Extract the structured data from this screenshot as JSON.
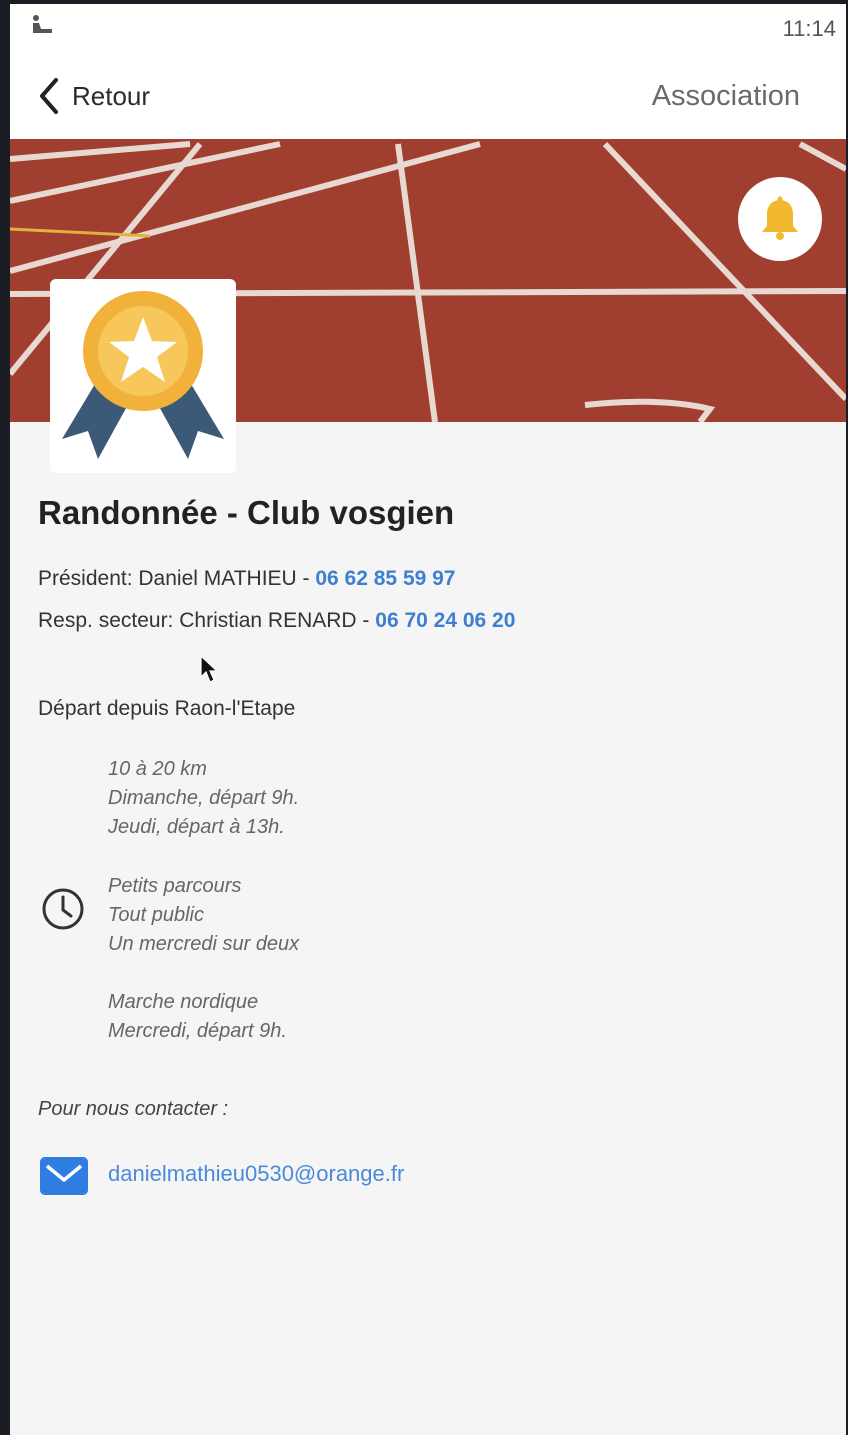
{
  "status_bar": {
    "time": "11:14",
    "left_icon": "accessibility-icon"
  },
  "nav": {
    "back_label": "Retour",
    "title": "Association"
  },
  "hero": {
    "bell_icon": "bell-icon",
    "logo_icon": "medal-icon"
  },
  "club": {
    "name": "Randonnée - Club vosgien",
    "president_label": "Président: Daniel MATHIEU - ",
    "president_phone": "06 62 85 59 97",
    "secteur_label": "Resp. secteur: Christian RENARD - ",
    "secteur_phone": "06 70 24 06 20",
    "depart": "Départ depuis Raon-l'Etape"
  },
  "schedule": [
    {
      "lines": [
        "10 à 20 km",
        "Dimanche, départ 9h.",
        "Jeudi, départ à 13h."
      ]
    },
    {
      "lines": [
        "Petits parcours",
        "Tout public",
        "Un mercredi sur deux"
      ]
    },
    {
      "lines": [
        "Marche nordique",
        "Mercredi, départ 9h."
      ]
    }
  ],
  "contact": {
    "heading": "Pour nous contacter :",
    "email": "danielmathieu0530@orange.fr"
  },
  "colors": {
    "accent": "#3f7fd1",
    "mail_icon_bg": "#2f7de0",
    "track": "#9a3b2c",
    "medal_gold": "#f2b13b",
    "ribbon": "#3c5a78"
  }
}
